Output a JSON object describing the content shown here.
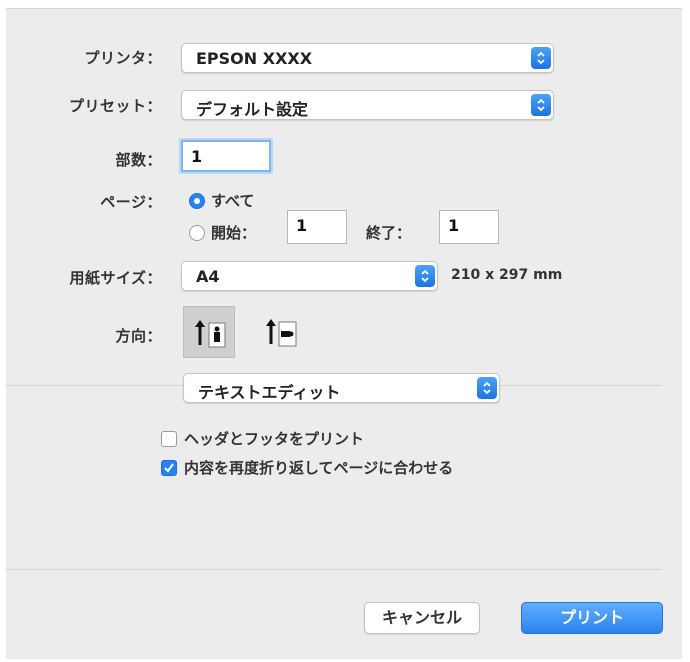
{
  "printer": {
    "label": "プリンタ：",
    "value": "EPSON XXXX"
  },
  "preset": {
    "label": "プリセット：",
    "value": "デフォルト設定"
  },
  "copies": {
    "label": "部数：",
    "value": "1"
  },
  "pages": {
    "label": "ページ：",
    "all_label": "すべて",
    "from_label": "開始：",
    "from_value": "1",
    "to_label": "終了：",
    "to_value": "1",
    "selected": "all"
  },
  "paper_size": {
    "label": "用紙サイズ：",
    "value": "A4",
    "dimensions": "210 x 297 mm"
  },
  "orientation": {
    "label": "方向：",
    "selected": "portrait"
  },
  "app_section": {
    "value": "テキストエディット"
  },
  "options": [
    {
      "label": "ヘッダとフッタをプリント",
      "checked": false
    },
    {
      "label": "内容を再度折り返してページに合わせる",
      "checked": true
    }
  ],
  "buttons": {
    "cancel": "キャンセル",
    "print": "プリント"
  },
  "colors": {
    "accent": "#2a82ef",
    "panel": "#ececec"
  }
}
